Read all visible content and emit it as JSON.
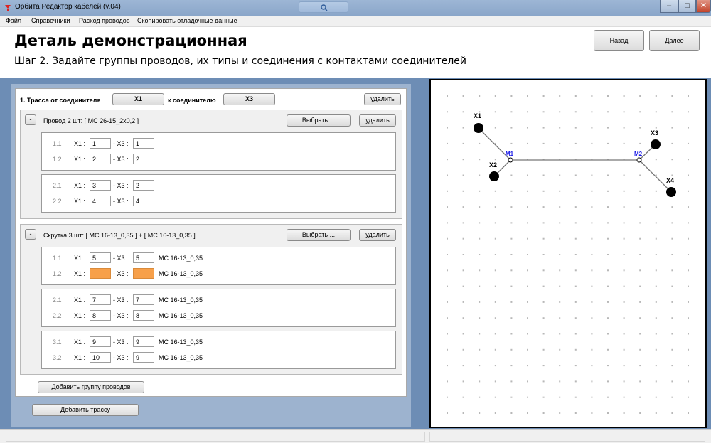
{
  "window": {
    "title": "Орбита Редактор кабелей (v.04)"
  },
  "menu": {
    "items": [
      "Файл",
      "Справочники",
      "Расход проводов",
      "Скопировать отладочные данные"
    ]
  },
  "header": {
    "title": "Деталь демонстрационная",
    "step": "Шаг 2. Задайте группы проводов, их типы и соединения с контактами соединителей",
    "back_label": "Назад",
    "next_label": "Далее"
  },
  "route": {
    "label": "1. Трасса от соединителя",
    "from": "X1",
    "to_label": "к соединителю",
    "to": "X3",
    "delete_label": "удалить"
  },
  "groups": [
    {
      "toggle": "-",
      "title": "Провод 2 шт: [ МС 26-15_2x0,2 ]",
      "choose_label": "Выбрать ...",
      "delete_label": "удалить",
      "subs": [
        {
          "rows": [
            {
              "idx": "1.1",
              "a": "X1 :",
              "av": "1",
              "b": "- X3 :",
              "bv": "1",
              "type": ""
            },
            {
              "idx": "1.2",
              "a": "X1 :",
              "av": "2",
              "b": "- X3 :",
              "bv": "2",
              "type": ""
            }
          ]
        },
        {
          "rows": [
            {
              "idx": "2.1",
              "a": "X1 :",
              "av": "3",
              "b": "- X3 :",
              "bv": "2",
              "type": ""
            },
            {
              "idx": "2.2",
              "a": "X1 :",
              "av": "4",
              "b": "- X3 :",
              "bv": "4",
              "type": ""
            }
          ]
        }
      ]
    },
    {
      "toggle": "-",
      "title": "Скрутка 3 шт: [ МС 16-13_0,35 ] + [ МС 16-13_0,35 ]",
      "choose_label": "Выбрать ...",
      "delete_label": "удалить",
      "subs": [
        {
          "rows": [
            {
              "idx": "1.1",
              "a": "X1 :",
              "av": "5",
              "b": "- X3 :",
              "bv": "5",
              "type": "МС 16-13_0,35"
            },
            {
              "idx": "1.2",
              "a": "X1 :",
              "av": "",
              "b": "- X3 :",
              "bv": "",
              "type": "МС 16-13_0,35"
            }
          ]
        },
        {
          "rows": [
            {
              "idx": "2.1",
              "a": "X1 :",
              "av": "7",
              "b": "- X3 :",
              "bv": "7",
              "type": "МС 16-13_0,35"
            },
            {
              "idx": "2.2",
              "a": "X1 :",
              "av": "8",
              "b": "- X3 :",
              "bv": "8",
              "type": "МС 16-13_0,35"
            }
          ]
        },
        {
          "rows": [
            {
              "idx": "3.1",
              "a": "X1 :",
              "av": "9",
              "b": "- X3 :",
              "bv": "9",
              "type": "МС 16-13_0,35"
            },
            {
              "idx": "3.2",
              "a": "X1 :",
              "av": "10",
              "b": "- X3 :",
              "bv": "9",
              "type": "МС 16-13_0,35"
            }
          ]
        }
      ]
    }
  ],
  "add_group_label": "Добавить группу проводов",
  "add_route_label": "Добавить трассу",
  "diagram": {
    "nodes": [
      "X1",
      "X2",
      "X3",
      "X4"
    ],
    "junctions": [
      "M1",
      "M2"
    ],
    "junction_color": "#1a1ae6",
    "highlight_color": "#f7a04a"
  }
}
